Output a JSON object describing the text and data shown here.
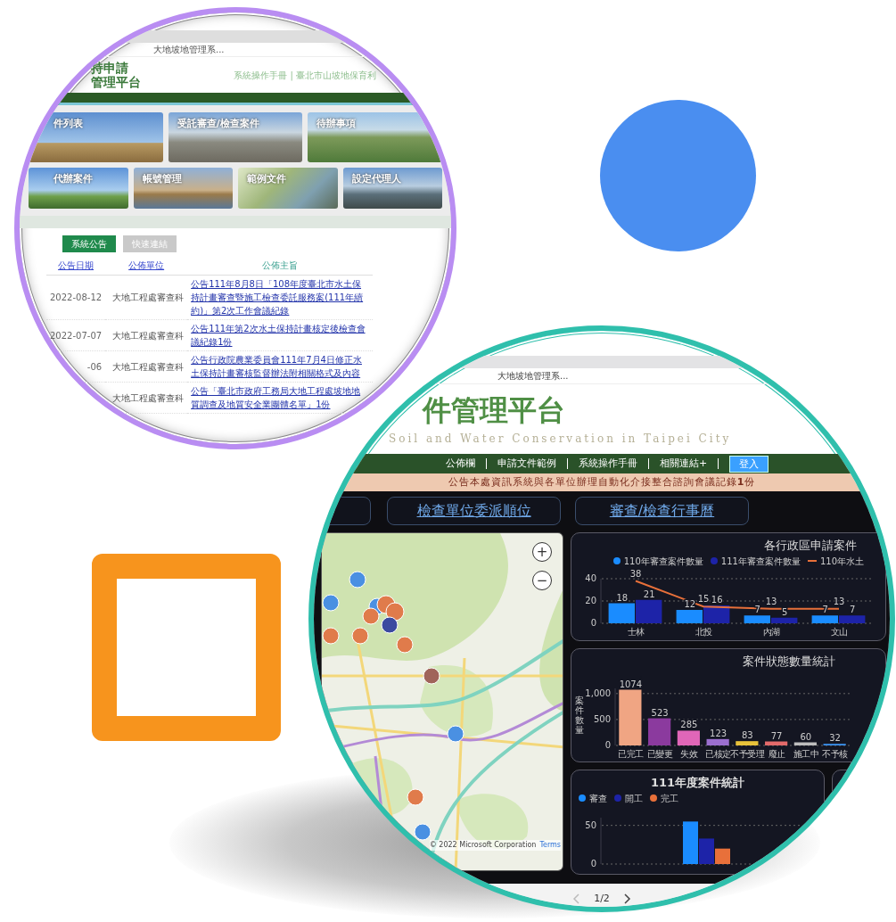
{
  "left_screen": {
    "browser_tab": "大地坡地管理系...",
    "logo_lines": [
      "持申請",
      "管理平台"
    ],
    "header_link": "系統操作手冊 | 臺北市山坡地保育利",
    "tiles": [
      {
        "label": "件列表"
      },
      {
        "label": "受託審查/檢查案件"
      },
      {
        "label": "待辦事項"
      },
      {
        "label": "代辦案件"
      },
      {
        "label": "帳號管理"
      },
      {
        "label": "範例文件"
      },
      {
        "label": "設定代理人"
      }
    ],
    "tabs": [
      {
        "label": "系統公告",
        "selected": true
      },
      {
        "label": "快速連結",
        "selected": false
      }
    ],
    "table": {
      "columns": [
        {
          "label": "公告日期",
          "link": true
        },
        {
          "label": "公佈單位",
          "link": true
        },
        {
          "label": "公佈主旨",
          "link": false
        }
      ],
      "rows": [
        {
          "date": "2022-08-12",
          "unit": "大地工程處審查科",
          "subject": "公告111年8月8日「108年度臺北市水土保持計畫審查暨施工檢查委託服務案(111年續約)」第2次工作會議紀錄"
        },
        {
          "date": "2022-07-07",
          "unit": "大地工程處審查科",
          "subject": "公告111年第2次水土保持計畫核定後檢查會議紀錄1份"
        },
        {
          "date": "-06",
          "unit": "大地工程處審查科",
          "subject": "公告行政院農業委員會111年7月4日修正水土保持計畫審核監督辦法附相關格式及內容"
        },
        {
          "date": "",
          "unit": "大地工程處審查科",
          "subject": "公告「臺北市政府工務局大地工程處坡地地質調查及地質安全業團體名單」1份"
        }
      ]
    }
  },
  "right_screen": {
    "browser_tab": "大地坡地管理系...",
    "title": "件管理平台",
    "subtitle": "Soil and Water Conservation in Taipei City",
    "nav": [
      {
        "label": "公佈欄",
        "kind": "link"
      },
      {
        "label": "申請文件範例",
        "kind": "link"
      },
      {
        "label": "系統操作手冊",
        "kind": "link"
      },
      {
        "label": "相關連結+",
        "kind": "link"
      },
      {
        "label": "登入",
        "kind": "button"
      }
    ],
    "announcement": "公告本處資訊系統與各單位辦理自動化介接整合諮詢會議記錄**1**份",
    "shortcuts": [
      "檢查單位委派順位",
      "審查/檢查行事曆"
    ],
    "map": {
      "zoom_in": "+",
      "zoom_out": "−",
      "attribution": "© 2022 Microsoft Corporation",
      "terms": "Terms"
    },
    "charts": [
      {
        "chart_data": {
          "type": "bar",
          "title": "各行政區申請案件",
          "categories": [
            "士林",
            "北投",
            "內湖",
            "文山"
          ],
          "data_labels": true,
          "ylim": [
            0,
            40
          ],
          "yticks": [
            0,
            20,
            40
          ],
          "series": [
            {
              "name": "110年審查案件數量",
              "color": "#1a8cff",
              "values": [
                18,
                12,
                7,
                7
              ]
            },
            {
              "name": "111年審查案件數量",
              "color": "#1d23a8",
              "values": [
                21,
                16,
                5,
                7
              ]
            },
            {
              "name": "110年水土",
              "type": "line",
              "color": "#e8703a",
              "values": [
                38,
                15,
                13,
                13
              ]
            }
          ]
        }
      },
      {
        "chart_data": {
          "type": "bar",
          "title": "案件狀態數量統計",
          "ylabel": "案件數量",
          "categories": [
            "已完工",
            "已變更",
            "失效",
            "已核定",
            "不予受理",
            "廢止",
            "施工中",
            "不予核"
          ],
          "data_labels": true,
          "ylim": [
            0,
            1100
          ],
          "yticks": [
            0,
            500,
            {
              "value": 1000,
              "label": "1,000"
            }
          ],
          "series": [
            {
              "values": [
                1074,
                523,
                285,
                123,
                83,
                77,
                60,
                32
              ],
              "colors": [
                "#f0a583",
                "#8b3a9e",
                "#e066b8",
                "#9b6fd0",
                "#e8c23a",
                "#e36a6a",
                "#bdbdbd",
                "#3a8ee8"
              ]
            }
          ]
        }
      },
      {
        "chart_data": {
          "type": "bar",
          "title": "111年度案件統計",
          "ylim": [
            0,
            60
          ],
          "yticks": [
            0,
            50
          ],
          "series": [
            {
              "name": "審查",
              "color": "#1a8cff",
              "values": [
                55
              ]
            },
            {
              "name": "開工",
              "color": "#1d23a8",
              "values": [
                33
              ]
            },
            {
              "name": "完工",
              "color": "#e8703a",
              "values": [
                20
              ]
            }
          ]
        }
      }
    ],
    "pager": {
      "page": "1/2"
    }
  }
}
